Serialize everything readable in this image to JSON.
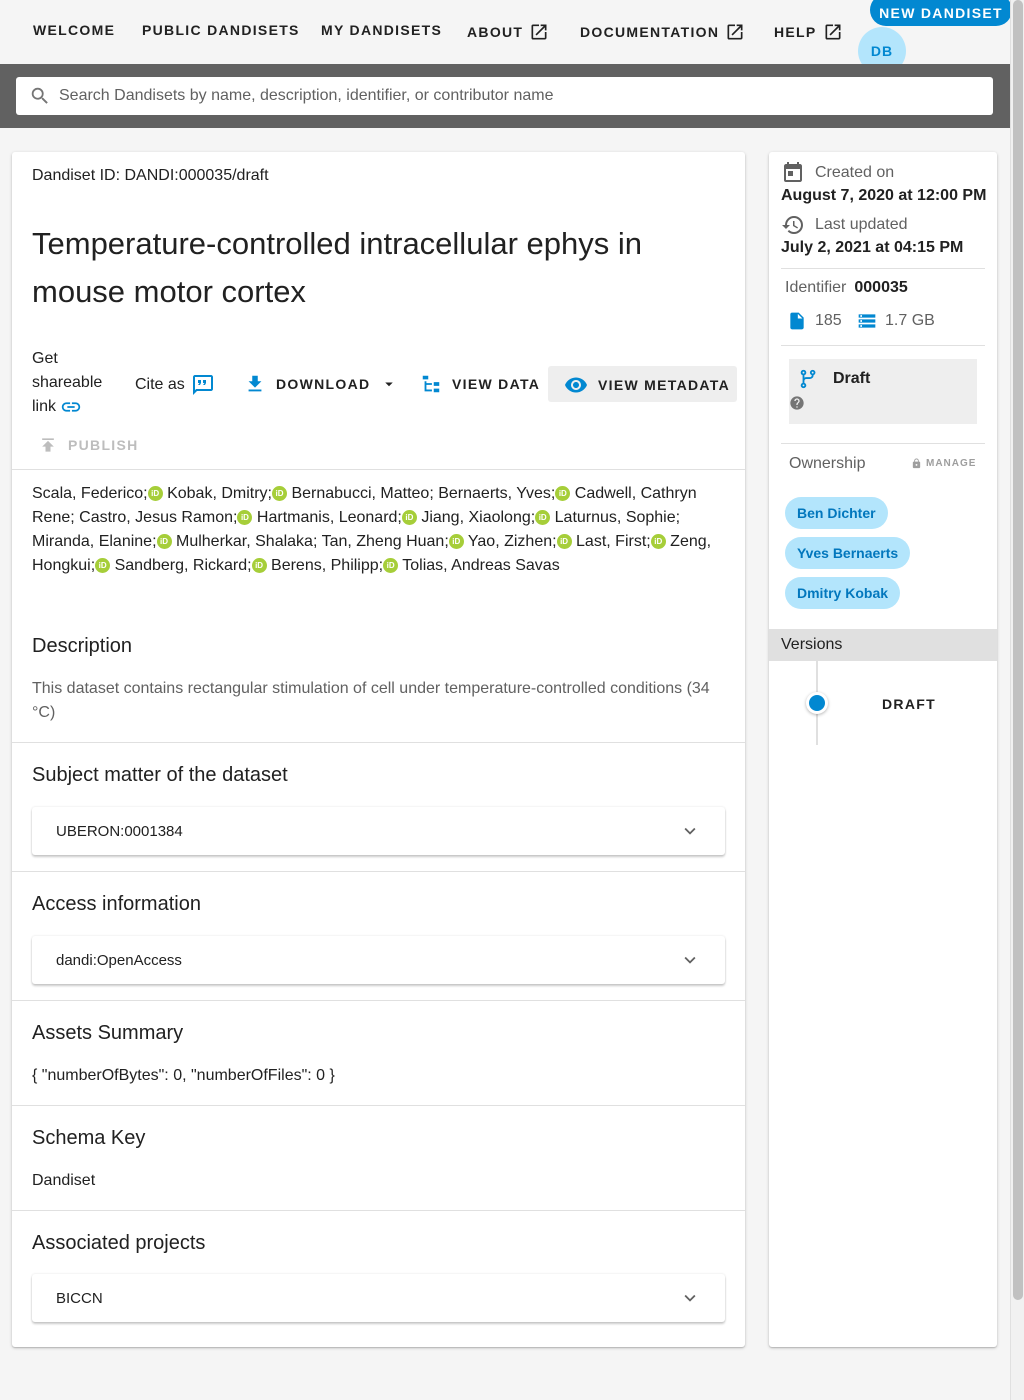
{
  "nav": {
    "welcome": "WELCOME",
    "public_dandisets": "PUBLIC DANDISETS",
    "my_dandisets": "MY DANDISETS",
    "about": "ABOUT",
    "documentation": "DOCUMENTATION",
    "help": "HELP",
    "new_dandiset": "NEW DANDISET",
    "avatar_initials": "DB"
  },
  "search": {
    "placeholder": "Search Dandisets by name, description, identifier, or contributor name"
  },
  "dandiset": {
    "id_line": "Dandiset ID: DANDI:000035/draft",
    "title": "Temperature-controlled intracellular ephys in mouse motor cortex"
  },
  "actions": {
    "shareable_link": "Get shareable link",
    "cite_as": "Cite as",
    "download": "DOWNLOAD",
    "view_data": "VIEW DATA",
    "view_metadata": "VIEW METADATA",
    "publish": "PUBLISH"
  },
  "contributors": [
    {
      "name": "Scala, Federico",
      "orcid": true
    },
    {
      "name": "Kobak, Dmitry",
      "orcid": true
    },
    {
      "name": "Bernabucci, Matteo",
      "orcid": false
    },
    {
      "name": "Bernaerts, Yves",
      "orcid": true
    },
    {
      "name": "Cadwell, Cathryn Rene",
      "orcid": false
    },
    {
      "name": "Castro, Jesus Ramon",
      "orcid": true
    },
    {
      "name": "Hartmanis, Leonard",
      "orcid": true
    },
    {
      "name": "Jiang, Xiaolong",
      "orcid": true
    },
    {
      "name": "Laturnus, Sophie",
      "orcid": false
    },
    {
      "name": "Miranda, Elanine",
      "orcid": true
    },
    {
      "name": "Mulherkar, Shalaka",
      "orcid": false
    },
    {
      "name": "Tan, Zheng Huan",
      "orcid": true
    },
    {
      "name": "Yao, Zizhen",
      "orcid": true
    },
    {
      "name": "Last, First",
      "orcid": true
    },
    {
      "name": "Zeng, Hongkui",
      "orcid": true
    },
    {
      "name": "Sandberg, Rickard",
      "orcid": true
    },
    {
      "name": "Berens, Philipp",
      "orcid": true
    },
    {
      "name": "Tolias, Andreas Savas",
      "orcid": false
    }
  ],
  "sections": {
    "description_title": "Description",
    "description_text": "This dataset contains rectangular stimulation of cell under temperature-controlled conditions (34 °C)",
    "subject_title": "Subject matter of the dataset",
    "subject_value": "UBERON:0001384",
    "access_title": "Access information",
    "access_value": "dandi:OpenAccess",
    "assets_title": "Assets Summary",
    "assets_value": "{ \"numberOfBytes\": 0, \"numberOfFiles\": 0 }",
    "schema_title": "Schema Key",
    "schema_value": "Dandiset",
    "projects_title": "Associated projects",
    "projects_value": "BICCN"
  },
  "sidebar": {
    "created_label": "Created on",
    "created_value": "August 7, 2020 at 12:00 PM",
    "updated_label": "Last updated",
    "updated_value": "July 2, 2021 at 04:15 PM",
    "identifier_label": "Identifier",
    "identifier_value": "000035",
    "file_count": "185",
    "size": "1.7 GB",
    "version_status": "Draft",
    "ownership_label": "Ownership",
    "manage_label": "MANAGE",
    "owners": [
      "Ben Dichter",
      "Yves Bernaerts",
      "Dmitry Kobak"
    ],
    "versions_label": "Versions",
    "versions": [
      "DRAFT"
    ]
  },
  "colors": {
    "accent": "#0288d1",
    "chip_bg": "#b3e5fc",
    "orcid": "#a6ce39",
    "search_band": "#616161"
  }
}
